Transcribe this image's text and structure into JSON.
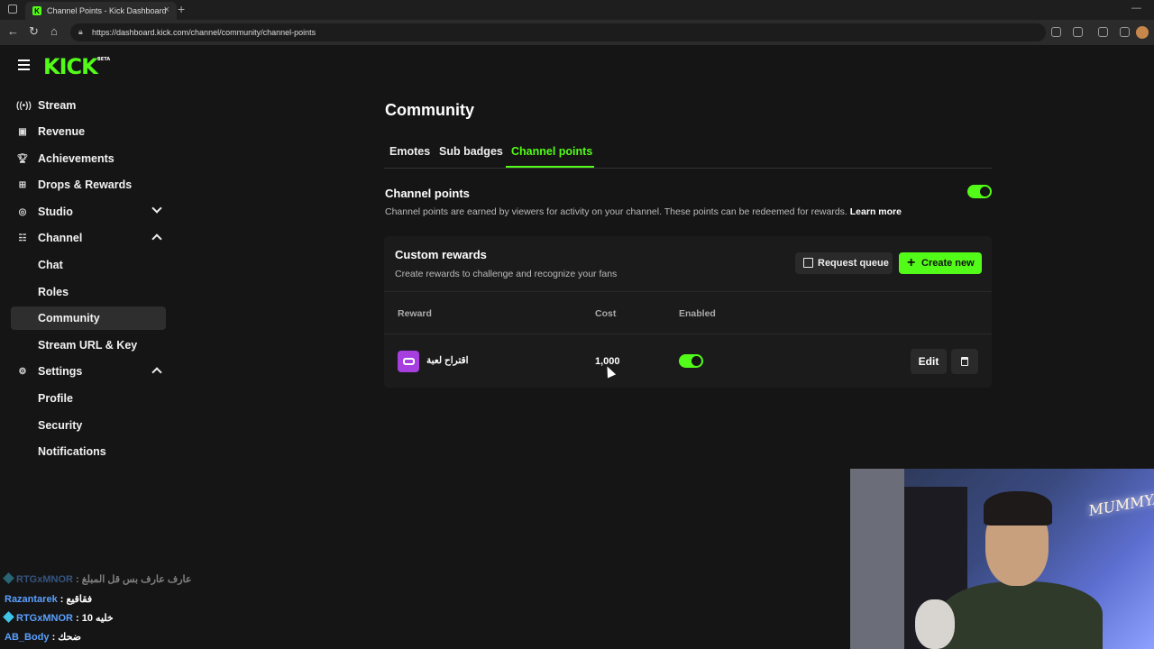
{
  "browser": {
    "tab_title": "Channel Points - Kick Dashboard",
    "url": "https://dashboard.kick.com/channel/community/channel-points"
  },
  "app": {
    "logo": "KICK",
    "logo_badge": "BETA"
  },
  "sidebar": {
    "items": [
      {
        "label": "Stream",
        "icon": "broadcast-icon"
      },
      {
        "label": "Revenue",
        "icon": "chart-icon"
      },
      {
        "label": "Achievements",
        "icon": "trophy-icon"
      },
      {
        "label": "Drops & Rewards",
        "icon": "gift-icon"
      },
      {
        "label": "Studio",
        "icon": "studio-icon",
        "expanded": false
      },
      {
        "label": "Channel",
        "icon": "channel-icon",
        "expanded": true
      },
      {
        "label": "Settings",
        "icon": "gear-icon",
        "expanded": true
      }
    ],
    "channel_children": [
      "Chat",
      "Roles",
      "Community",
      "Stream URL & Key"
    ],
    "settings_children": [
      "Profile",
      "Security",
      "Notifications"
    ],
    "active": "Community"
  },
  "main": {
    "title": "Community",
    "tabs": [
      "Emotes",
      "Sub badges",
      "Channel points"
    ],
    "active_tab": "Channel points",
    "channel_points": {
      "title": "Channel points",
      "description": "Channel points are earned by viewers for activity on your channel. These points can be redeemed for rewards.",
      "learn_more": "Learn more",
      "enabled": true
    },
    "custom_rewards": {
      "title": "Custom rewards",
      "subtitle": "Create rewards to challenge and recognize your fans",
      "request_queue": "Request queue",
      "create_new": "Create new",
      "columns": [
        "Reward",
        "Cost",
        "Enabled"
      ],
      "rows": [
        {
          "name": "اقتراح لعبة",
          "cost": "1,000",
          "enabled": true,
          "edit": "Edit"
        }
      ]
    }
  },
  "chat_overlay": [
    {
      "user": "RTGxMNOR",
      "message": "عارف عارف بس قل المبلغ",
      "gem": true,
      "faded": true
    },
    {
      "user": "Razantarek",
      "message": "فقاقيع",
      "gem": false,
      "faded": false
    },
    {
      "user": "RTGxMNOR",
      "message": "خليه 10",
      "gem": true,
      "faded": false
    },
    {
      "user": "AB_Body",
      "message": "ضحك",
      "gem": false,
      "faded": false
    }
  ],
  "webcam": {
    "neon_sign": "MUMMYA"
  },
  "colors": {
    "accent": "#53fc18",
    "background": "#151515",
    "reward_icon": "#a73fe0"
  }
}
